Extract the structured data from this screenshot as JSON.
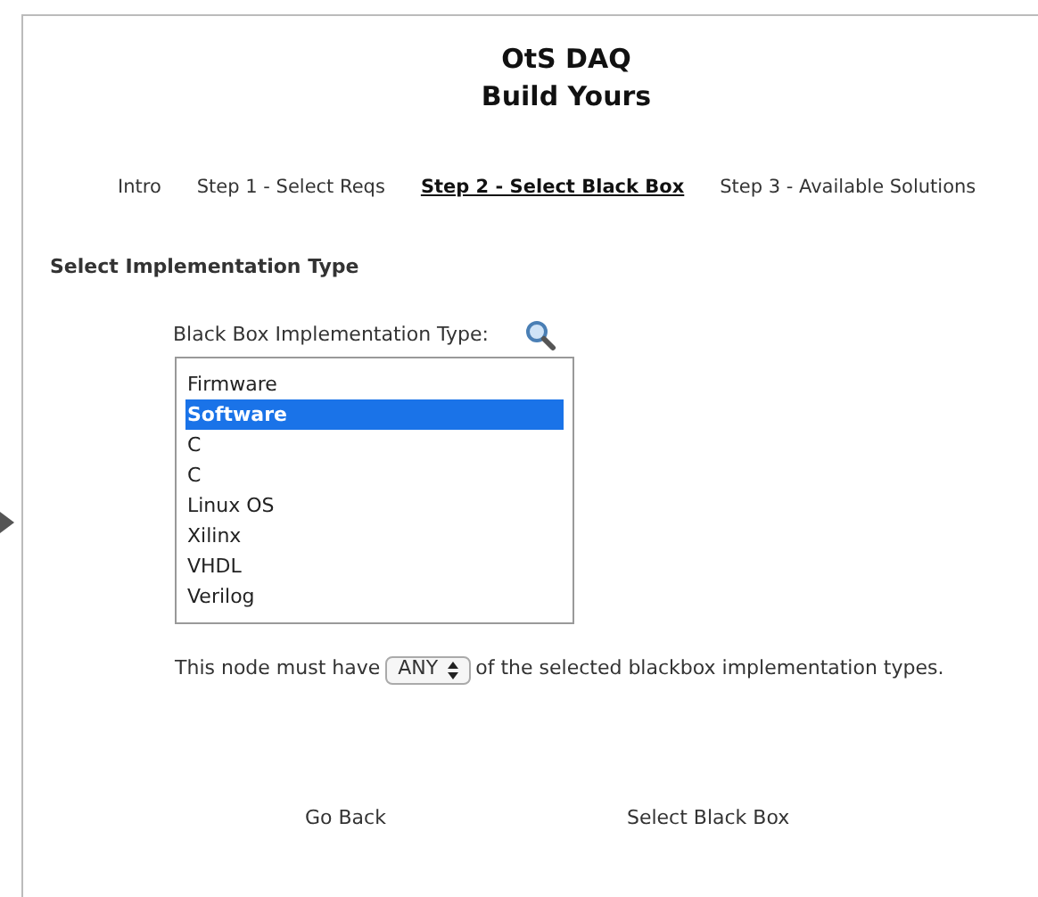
{
  "header": {
    "title": "OtS DAQ",
    "subtitle": "Build Yours"
  },
  "steps": [
    {
      "label": "Intro",
      "selected": false
    },
    {
      "label": "Step 1 - Select Reqs",
      "selected": false
    },
    {
      "label": "Step 2 - Select Black Box",
      "selected": true
    },
    {
      "label": "Step 3 - Available Solutions",
      "selected": false
    }
  ],
  "section_title": "Select Implementation Type",
  "listbox": {
    "label": "Black Box Implementation Type:",
    "options": [
      {
        "label": "Firmware",
        "selected": false
      },
      {
        "label": "Software",
        "selected": true
      },
      {
        "label": "C",
        "selected": false
      },
      {
        "label": "C",
        "selected": false
      },
      {
        "label": "Linux OS",
        "selected": false
      },
      {
        "label": "Xilinx",
        "selected": false
      },
      {
        "label": "VHDL",
        "selected": false
      },
      {
        "label": "Verilog",
        "selected": false
      }
    ]
  },
  "requirement": {
    "before": "This node must have",
    "value": "ANY",
    "after": "of the selected blackbox implementation types."
  },
  "buttons": [
    "Go Back",
    "Select Black Box"
  ]
}
